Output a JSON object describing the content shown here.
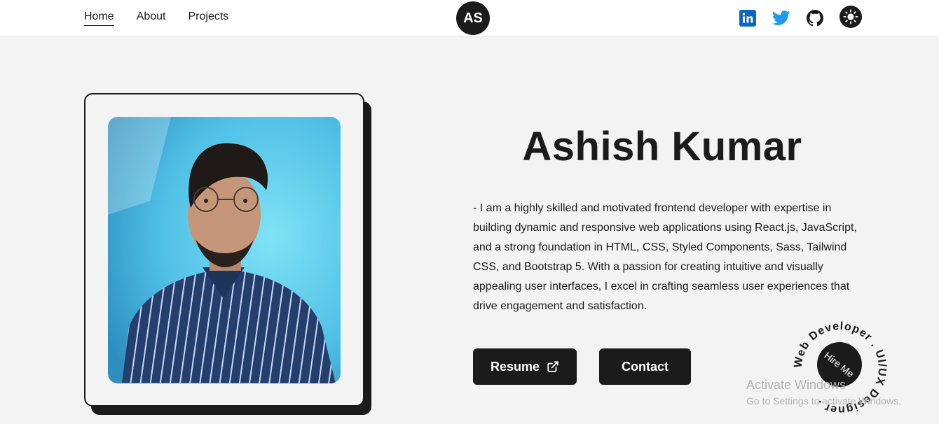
{
  "nav": {
    "links": [
      {
        "label": "Home",
        "active": true
      },
      {
        "label": "About",
        "active": false
      },
      {
        "label": "Projects",
        "active": false
      }
    ],
    "logo": "AS",
    "social": [
      "linkedin-icon",
      "twitter-icon",
      "github-icon",
      "theme-toggle-icon"
    ]
  },
  "hero": {
    "name": "Ashish Kumar",
    "bio": "- I am a highly skilled and motivated frontend developer with expertise in building dynamic and responsive web applications using React.js, JavaScript, and a strong foundation in HTML, CSS, Styled Components, Sass, Tailwind CSS, and Bootstrap 5. With a passion for creating intuitive and visually appealing user interfaces, I excel in crafting seamless user experiences that drive engagement and satisfaction.",
    "resume_label": "Resume",
    "contact_label": "Contact"
  },
  "badge": {
    "circular_text": "Web Developer . UI/UX Designer .",
    "center_label": "Hire Me"
  },
  "watermark": {
    "title": "Activate Windows",
    "subtitle": "Go to Settings to activate Windows."
  },
  "colors": {
    "background": "#f3f3f3",
    "dark": "#1b1b1b",
    "linkedin": "#0a66c2",
    "twitter": "#1d9bf0",
    "photo_bg": "#5cc6e6"
  }
}
